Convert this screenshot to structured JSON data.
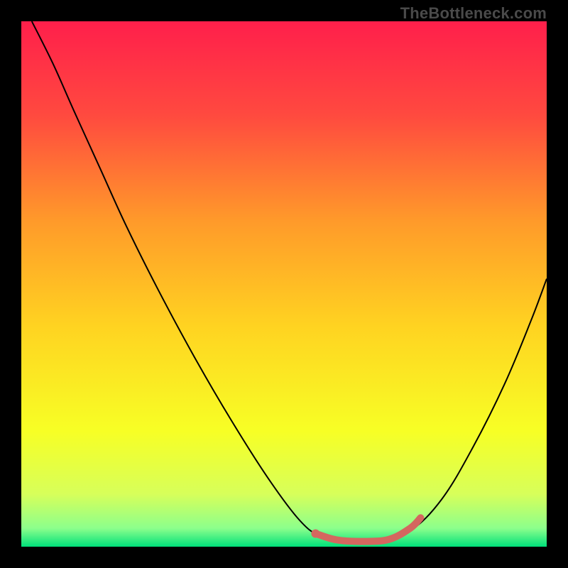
{
  "watermark": "TheBottleneck.com",
  "chart_data": {
    "type": "line",
    "title": "",
    "xlabel": "",
    "ylabel": "",
    "xlim": [
      0,
      100
    ],
    "ylim": [
      0,
      100
    ],
    "background_gradient": {
      "stops": [
        {
          "offset": 0.0,
          "color": "#ff1f4b"
        },
        {
          "offset": 0.18,
          "color": "#ff4a3f"
        },
        {
          "offset": 0.38,
          "color": "#ff9a2a"
        },
        {
          "offset": 0.58,
          "color": "#ffd321"
        },
        {
          "offset": 0.78,
          "color": "#f7ff25"
        },
        {
          "offset": 0.9,
          "color": "#d7ff5a"
        },
        {
          "offset": 0.965,
          "color": "#8cff8c"
        },
        {
          "offset": 1.0,
          "color": "#00e07a"
        }
      ]
    },
    "series": [
      {
        "name": "bottleneck-curve",
        "stroke": "#000000",
        "stroke_width": 2,
        "points": [
          {
            "x": 2,
            "y": 100
          },
          {
            "x": 6,
            "y": 92
          },
          {
            "x": 10,
            "y": 83
          },
          {
            "x": 15,
            "y": 72
          },
          {
            "x": 20,
            "y": 61
          },
          {
            "x": 26,
            "y": 49
          },
          {
            "x": 33,
            "y": 36
          },
          {
            "x": 40,
            "y": 24
          },
          {
            "x": 47,
            "y": 13
          },
          {
            "x": 53,
            "y": 5
          },
          {
            "x": 57,
            "y": 2
          },
          {
            "x": 62,
            "y": 1
          },
          {
            "x": 68,
            "y": 1
          },
          {
            "x": 74,
            "y": 3
          },
          {
            "x": 80,
            "y": 9
          },
          {
            "x": 86,
            "y": 19
          },
          {
            "x": 92,
            "y": 31
          },
          {
            "x": 97,
            "y": 43
          },
          {
            "x": 100,
            "y": 51
          }
        ]
      },
      {
        "name": "highlight-range",
        "stroke": "#d4675f",
        "stroke_width": 10,
        "linecap": "round",
        "points": [
          {
            "x": 56,
            "y": 2.5
          },
          {
            "x": 60,
            "y": 1.3
          },
          {
            "x": 65,
            "y": 1.0
          },
          {
            "x": 70,
            "y": 1.4
          },
          {
            "x": 74,
            "y": 3.5
          },
          {
            "x": 76,
            "y": 5.5
          }
        ]
      }
    ],
    "markers": [
      {
        "name": "highlight-start-dot",
        "x": 56,
        "y": 2.5,
        "r": 6,
        "color": "#d4675f"
      }
    ]
  }
}
